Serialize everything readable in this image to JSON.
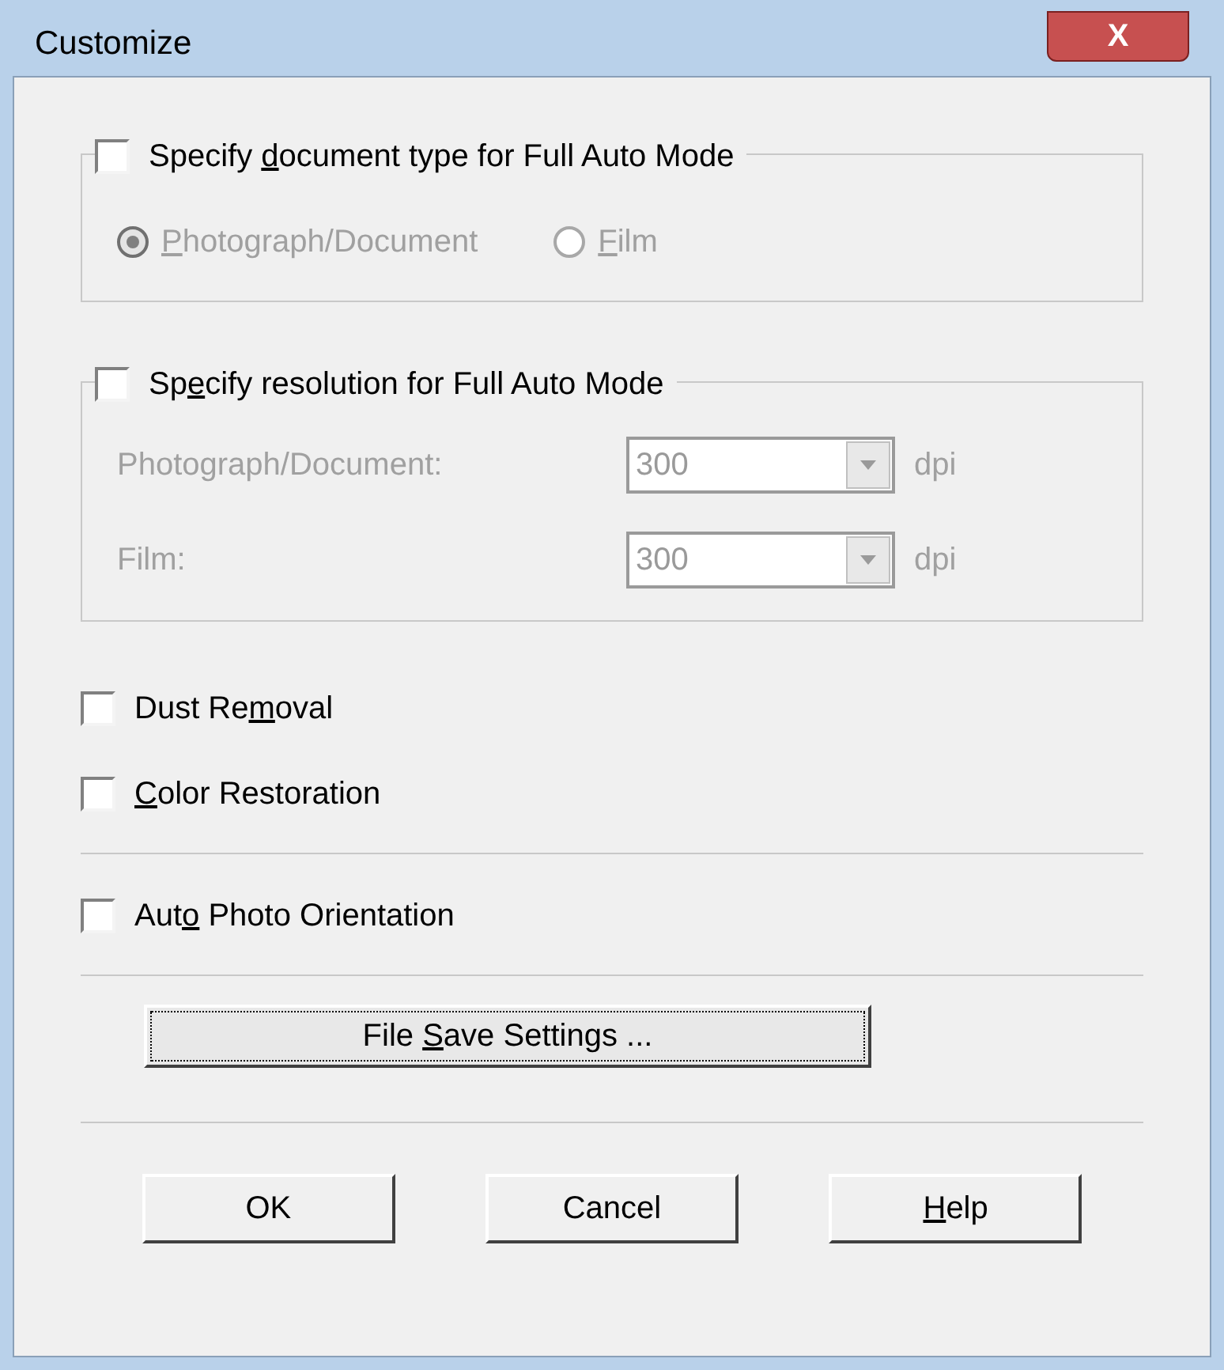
{
  "window": {
    "title": "Customize",
    "close": "X"
  },
  "doc_type_group": {
    "checkbox": {
      "label": {
        "pre": "Specify ",
        "key": "d",
        "post": "ocument type for Full Auto Mode"
      },
      "checked": false
    },
    "disabled": true,
    "radios": [
      {
        "label": {
          "key": "P",
          "post": "hotograph/Document"
        },
        "selected": true
      },
      {
        "label": {
          "key": "F",
          "post": "ilm"
        },
        "selected": false
      }
    ]
  },
  "resolution_group": {
    "checkbox": {
      "label": {
        "pre": "Sp",
        "key": "e",
        "post": "cify resolution for Full Auto Mode"
      },
      "checked": false
    },
    "disabled": true,
    "rows": [
      {
        "label": "Photograph/Document:",
        "value": "300",
        "unit": "dpi"
      },
      {
        "label": "Film:",
        "value": "300",
        "unit": "dpi"
      }
    ]
  },
  "options": [
    {
      "kind": "checkbox",
      "label": {
        "pre": "Dust Re",
        "key": "m",
        "post": "oval"
      },
      "checked": false
    },
    {
      "kind": "checkbox",
      "label": {
        "key": "C",
        "post": "olor Restoration"
      },
      "checked": false
    },
    {
      "kind": "separator"
    },
    {
      "kind": "checkbox",
      "label": {
        "pre": "Aut",
        "key": "o",
        "post": " Photo Orientation"
      },
      "checked": false
    },
    {
      "kind": "separator"
    }
  ],
  "file_save_button": {
    "pre": "File ",
    "key": "S",
    "post": "ave Settings ..."
  },
  "buttons": [
    {
      "pre": "OK"
    },
    {
      "pre": "Cancel"
    },
    {
      "key": "H",
      "post": "elp"
    }
  ]
}
